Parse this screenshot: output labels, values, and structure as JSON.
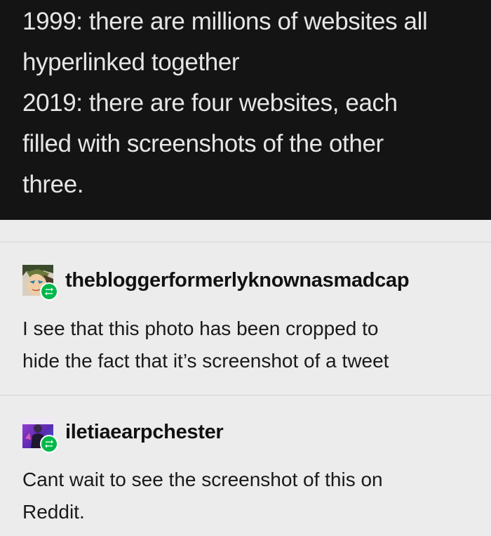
{
  "tweet": {
    "lines": [
      "1999: there are millions of websites all",
      "hyperlinked together",
      "2019: there are four websites, each",
      "filled with screenshots of the other",
      "three."
    ]
  },
  "posts": [
    {
      "username": "thebloggerformerlyknownasmadcap",
      "avatar_icon": "anime-face-avatar",
      "badge_icon": "reblog-icon",
      "lines": [
        "I see that this photo has been cropped to",
        "hide the fact that it’s screenshot of a tweet"
      ]
    },
    {
      "username": "iletiaearpchester",
      "avatar_icon": "purple-photo-avatar",
      "badge_icon": "reblog-icon",
      "lines": [
        "Cant wait to see the screenshot of this on",
        "Reddit."
      ]
    }
  ],
  "colors": {
    "dark_background": "#141414",
    "page_background": "#ececec",
    "reblog_green": "#00b84a"
  }
}
